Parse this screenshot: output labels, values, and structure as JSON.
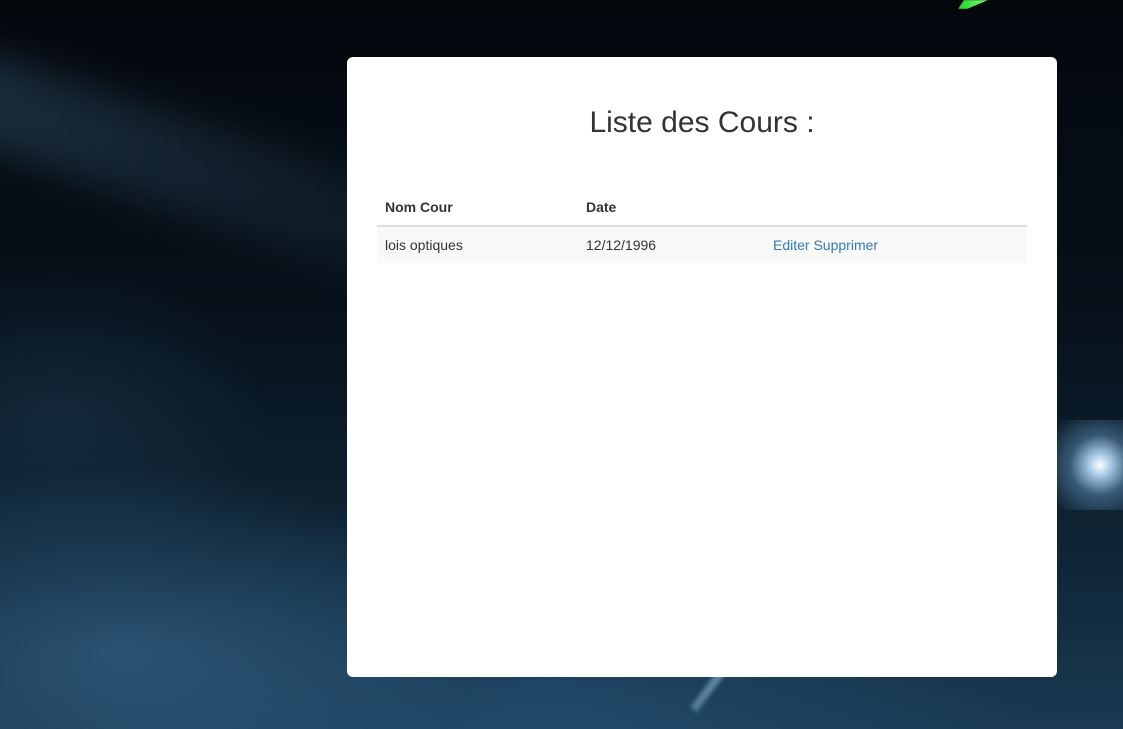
{
  "page": {
    "title": "Liste des Cours :"
  },
  "table": {
    "headers": {
      "name": "Nom Cour",
      "date": "Date"
    },
    "rows": [
      {
        "name": "lois optiques",
        "date": "12/12/1996",
        "edit_label": "Editer",
        "delete_label": "Supprimer"
      }
    ]
  },
  "colors": {
    "link": "#337ab7",
    "text": "#333333",
    "row_stripe": "#f9f9f9",
    "card_background": "#ffffff"
  }
}
